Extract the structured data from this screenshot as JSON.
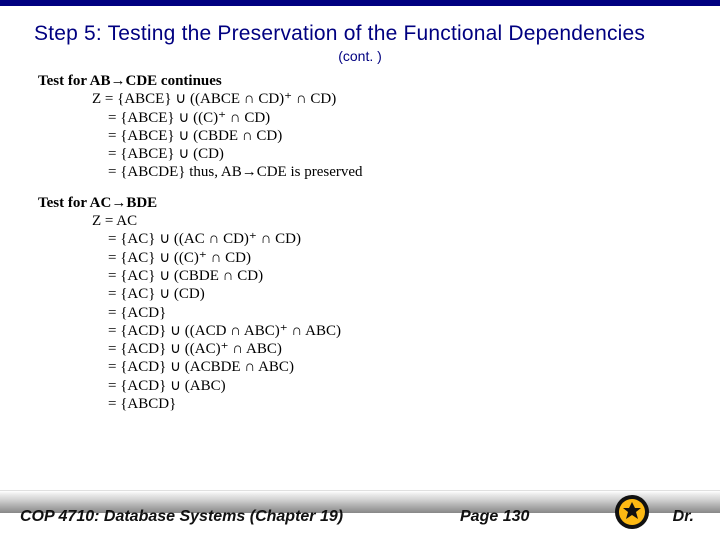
{
  "title": "Step 5: Testing the Preservation of the Functional Dependencies",
  "subtitle": "(cont. )",
  "section1": {
    "heading": "Test for AB→CDE continues",
    "lines": [
      "Z = {ABCE} ∪ ((ABCE ∩ CD)⁺ ∩ CD)",
      "= {ABCE} ∪ ((C)⁺ ∩ CD)",
      "= {ABCE} ∪ (CBDE ∩ CD)",
      "= {ABCE} ∪ (CD)",
      "= {ABCDE} thus, AB→CDE is preserved"
    ]
  },
  "section2": {
    "heading": "Test for AC→BDE",
    "lines": [
      "Z = AC",
      "= {AC} ∪ ((AC ∩ CD)⁺ ∩ CD)",
      "= {AC} ∪ ((C)⁺ ∩ CD)",
      "= {AC} ∪ (CBDE ∩ CD)",
      "= {AC} ∪ (CD)",
      "= {ACD}",
      "= {ACD} ∪ ((ACD ∩ ABC)⁺ ∩ ABC)",
      "= {ACD} ∪ ((AC)⁺ ∩ ABC)",
      "= {ACD} ∪ (ACBDE ∩ ABC)",
      "= {ACD} ∪ (ABC)",
      "= {ABCD}"
    ]
  },
  "footer": {
    "course": "COP 4710: Database Systems  (Chapter 19)",
    "page": "Page 130",
    "author": "Dr."
  }
}
